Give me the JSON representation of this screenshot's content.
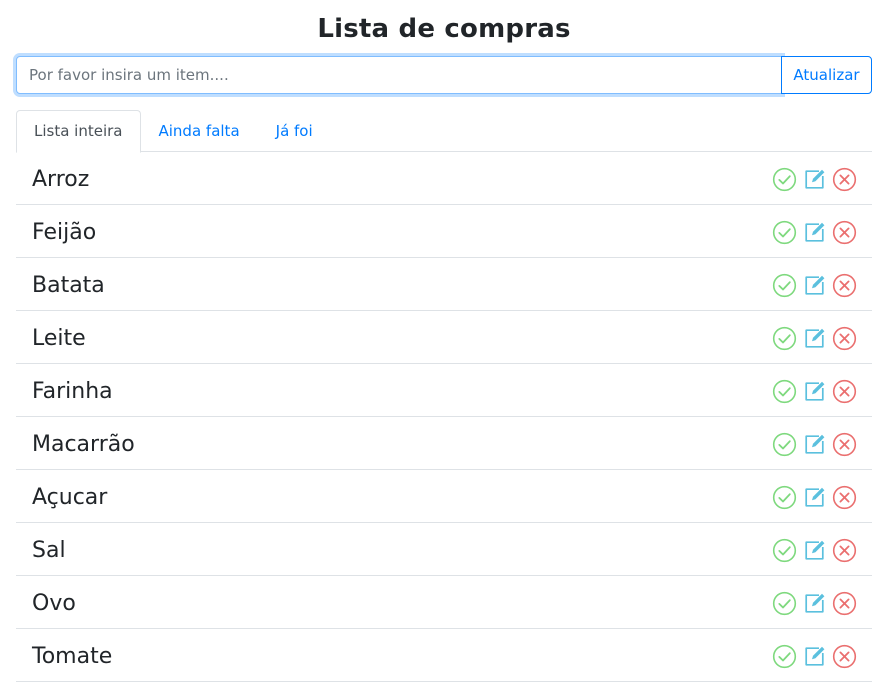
{
  "header": {
    "title": "Lista de compras"
  },
  "input": {
    "placeholder": "Por favor insira um item....",
    "value": ""
  },
  "update_button": {
    "label": "Atualizar"
  },
  "tabs": [
    {
      "label": "Lista inteira",
      "active": true
    },
    {
      "label": "Ainda falta",
      "active": false
    },
    {
      "label": "Já foi",
      "active": false
    }
  ],
  "items": [
    {
      "name": "Arroz"
    },
    {
      "name": "Feijão"
    },
    {
      "name": "Batata"
    },
    {
      "name": "Leite"
    },
    {
      "name": "Farinha"
    },
    {
      "name": "Macarrão"
    },
    {
      "name": "Açucar"
    },
    {
      "name": "Sal"
    },
    {
      "name": "Ovo"
    },
    {
      "name": "Tomate"
    }
  ],
  "icons": {
    "check": "check-circle-icon",
    "edit": "edit-icon",
    "delete": "close-circle-icon"
  },
  "colors": {
    "accent": "#007bff",
    "check": "#7ed97e",
    "edit": "#5bc0de",
    "delete": "#ea6f6f"
  }
}
